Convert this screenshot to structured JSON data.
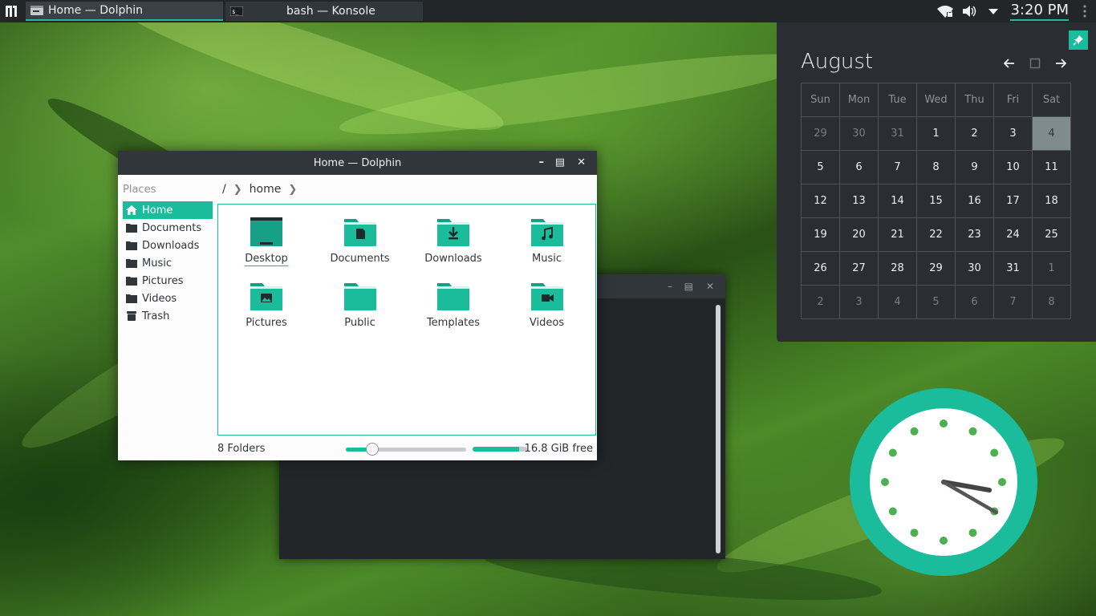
{
  "panel": {
    "tasks": [
      {
        "label": "Home — Dolphin",
        "icon": "dolphin-icon",
        "active": true
      },
      {
        "label": "bash — Konsole",
        "icon": "terminal-icon",
        "active": false
      }
    ],
    "time": "3:20 PM",
    "tray_icons": [
      "network-wifi-icon",
      "volume-icon",
      "tray-expand-icon"
    ],
    "accent": "#1abc9c"
  },
  "calendar": {
    "month": "August",
    "weekdays": [
      "Sun",
      "Mon",
      "Tue",
      "Wed",
      "Thu",
      "Fri",
      "Sat"
    ],
    "weeks": [
      [
        "29",
        "30",
        "31",
        "1",
        "2",
        "3",
        "4"
      ],
      [
        "5",
        "6",
        "7",
        "8",
        "9",
        "10",
        "11"
      ],
      [
        "12",
        "13",
        "14",
        "15",
        "16",
        "17",
        "18"
      ],
      [
        "19",
        "20",
        "21",
        "22",
        "23",
        "24",
        "25"
      ],
      [
        "26",
        "27",
        "28",
        "29",
        "30",
        "31",
        "1"
      ],
      [
        "2",
        "3",
        "4",
        "5",
        "6",
        "7",
        "8"
      ]
    ],
    "today": "4"
  },
  "dolphin": {
    "title": "Home — Dolphin",
    "places_title": "Places",
    "places": [
      {
        "label": "Home",
        "icon": "home-icon",
        "active": true
      },
      {
        "label": "Documents",
        "icon": "folder-icon",
        "active": false
      },
      {
        "label": "Downloads",
        "icon": "folder-icon",
        "active": false
      },
      {
        "label": "Music",
        "icon": "folder-icon",
        "active": false
      },
      {
        "label": "Pictures",
        "icon": "folder-icon",
        "active": false
      },
      {
        "label": "Videos",
        "icon": "folder-icon",
        "active": false
      },
      {
        "label": "Trash",
        "icon": "trash-icon",
        "active": false
      }
    ],
    "breadcrumb": [
      "/",
      "home"
    ],
    "folders": [
      {
        "label": "Desktop",
        "icon": "desktop-folder-icon"
      },
      {
        "label": "Documents",
        "icon": "documents-folder-icon"
      },
      {
        "label": "Downloads",
        "icon": "downloads-folder-icon"
      },
      {
        "label": "Music",
        "icon": "music-folder-icon"
      },
      {
        "label": "Pictures",
        "icon": "pictures-folder-icon"
      },
      {
        "label": "Public",
        "icon": "public-folder-icon"
      },
      {
        "label": "Templates",
        "icon": "templates-folder-icon"
      },
      {
        "label": "Videos",
        "icon": "videos-folder-icon"
      }
    ],
    "status": "8 Folders",
    "free_space": "16.8 GiB free",
    "zoom_level": 0.22,
    "disk_used_fraction": 0.85
  },
  "konsole": {
    "title": "bash — Konsole"
  },
  "analog_clock": {
    "hour": 3,
    "minute": 20,
    "face": "#ffffff",
    "rim": "#1abc9c",
    "dots": "#4caf50"
  }
}
